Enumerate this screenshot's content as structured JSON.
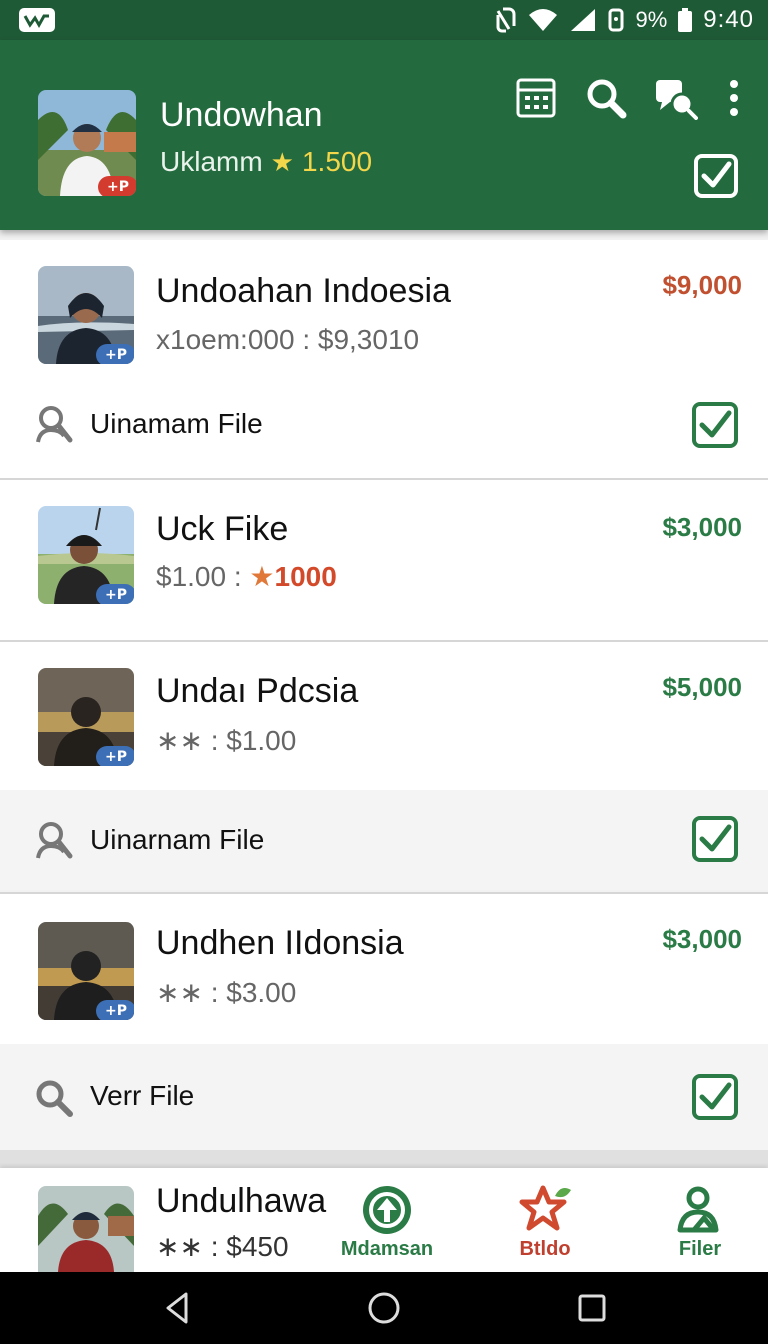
{
  "status_bar": {
    "battery": "9%",
    "time": "9:40"
  },
  "header": {
    "title": "Undowhan",
    "subtitle": "Uklamm",
    "rating": "1.500",
    "avatar_badge": "+P"
  },
  "items": [
    {
      "title": "Undoahan Indoesia",
      "sub": "x1oem:000 : $9,3010",
      "price": "$9,000",
      "badge": "+P"
    },
    {
      "title": "Uck Fike",
      "sub_prefix": "$1.00 : ",
      "sub_highlight": "1000",
      "price": "$3,000",
      "badge": "+P"
    },
    {
      "title": "Undaı Pdcsia",
      "sub": "∗∗ : $1.00",
      "price": "$5,000",
      "badge": "+P"
    },
    {
      "title": "Undhen IIdonsia",
      "sub": "∗∗ : $3.00",
      "price": "$3,000",
      "badge": "+P"
    },
    {
      "title": "Undulhawa",
      "sub": "∗∗ : $450"
    }
  ],
  "file_rows": [
    {
      "label": "Uinamam File"
    },
    {
      "label": "Uinarnam File"
    },
    {
      "label": "Verr File"
    }
  ],
  "bottom_nav": [
    {
      "label": "Mdamsan"
    },
    {
      "label": "Btldo"
    },
    {
      "label": "Filer"
    }
  ],
  "colors": {
    "header_green": "#236b3e",
    "accent_green": "#2a7b45",
    "price_red": "#c05030",
    "badge_red": "#d43b2f",
    "badge_blue": "#3d6fb6"
  }
}
